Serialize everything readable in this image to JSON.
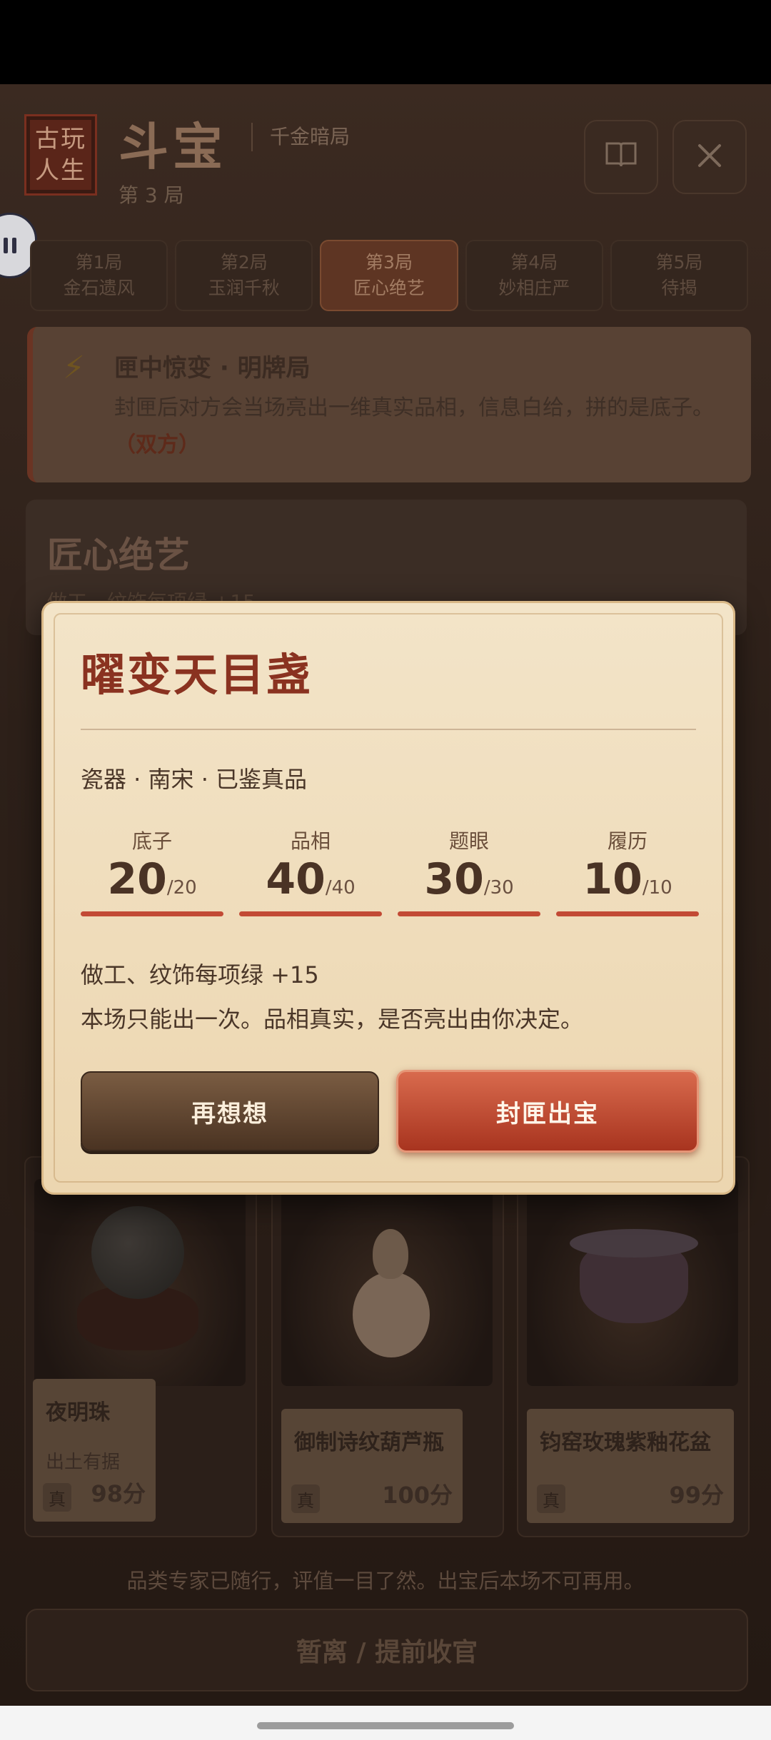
{
  "header": {
    "logo_line1": "古玩",
    "logo_line2": "人生",
    "title": "斗宝",
    "subtitle": "千金暗局",
    "round": "第 3 局"
  },
  "tabs": [
    {
      "round": "第1局",
      "name": "金石遗风",
      "active": false
    },
    {
      "round": "第2局",
      "name": "玉润千秋",
      "active": false
    },
    {
      "round": "第3局",
      "name": "匠心绝艺",
      "active": true
    },
    {
      "round": "第4局",
      "name": "妙相庄严",
      "active": false
    },
    {
      "round": "第5局",
      "name": "待揭",
      "active": false
    }
  ],
  "event": {
    "title": "匣中惊变 · 明牌局",
    "desc": "封匣后对方会当场亮出一维真实品相，信息白给，拼的是底子。",
    "tag": "（双方）"
  },
  "craft": {
    "title": "匠心绝艺",
    "sub": "做工、纹饰每项绿 +15"
  },
  "items": [
    {
      "name": "夜明珠",
      "note": "出土有据",
      "tag": "真",
      "score": "98分"
    },
    {
      "name": "御制诗纹葫芦瓶",
      "tag": "真",
      "score": "100分"
    },
    {
      "name": "钧窑玫瑰紫釉花盆",
      "tag": "真",
      "score": "99分"
    }
  ],
  "hint": "品类专家已随行，评值一目了然。出宝后本场不可再用。",
  "exit_button": "暂离 / 提前收官",
  "modal": {
    "title": "曜变天目盏",
    "meta": "瓷器 · 南宋 · 已鉴真品",
    "stats": [
      {
        "label": "底子",
        "value": "20",
        "max": "/20"
      },
      {
        "label": "品相",
        "value": "40",
        "max": "/40"
      },
      {
        "label": "题眼",
        "value": "30",
        "max": "/30"
      },
      {
        "label": "履历",
        "value": "10",
        "max": "/10"
      }
    ],
    "line1": "做工、纹饰每项绿 +15",
    "line2": "本场只能出一次。品相真实，是否亮出由你决定。",
    "cancel": "再想想",
    "confirm": "封匣出宝"
  },
  "colors": {
    "accent": "#8a3220",
    "confirm": "#c24a35",
    "modal_bg": "#f3e4c8"
  }
}
